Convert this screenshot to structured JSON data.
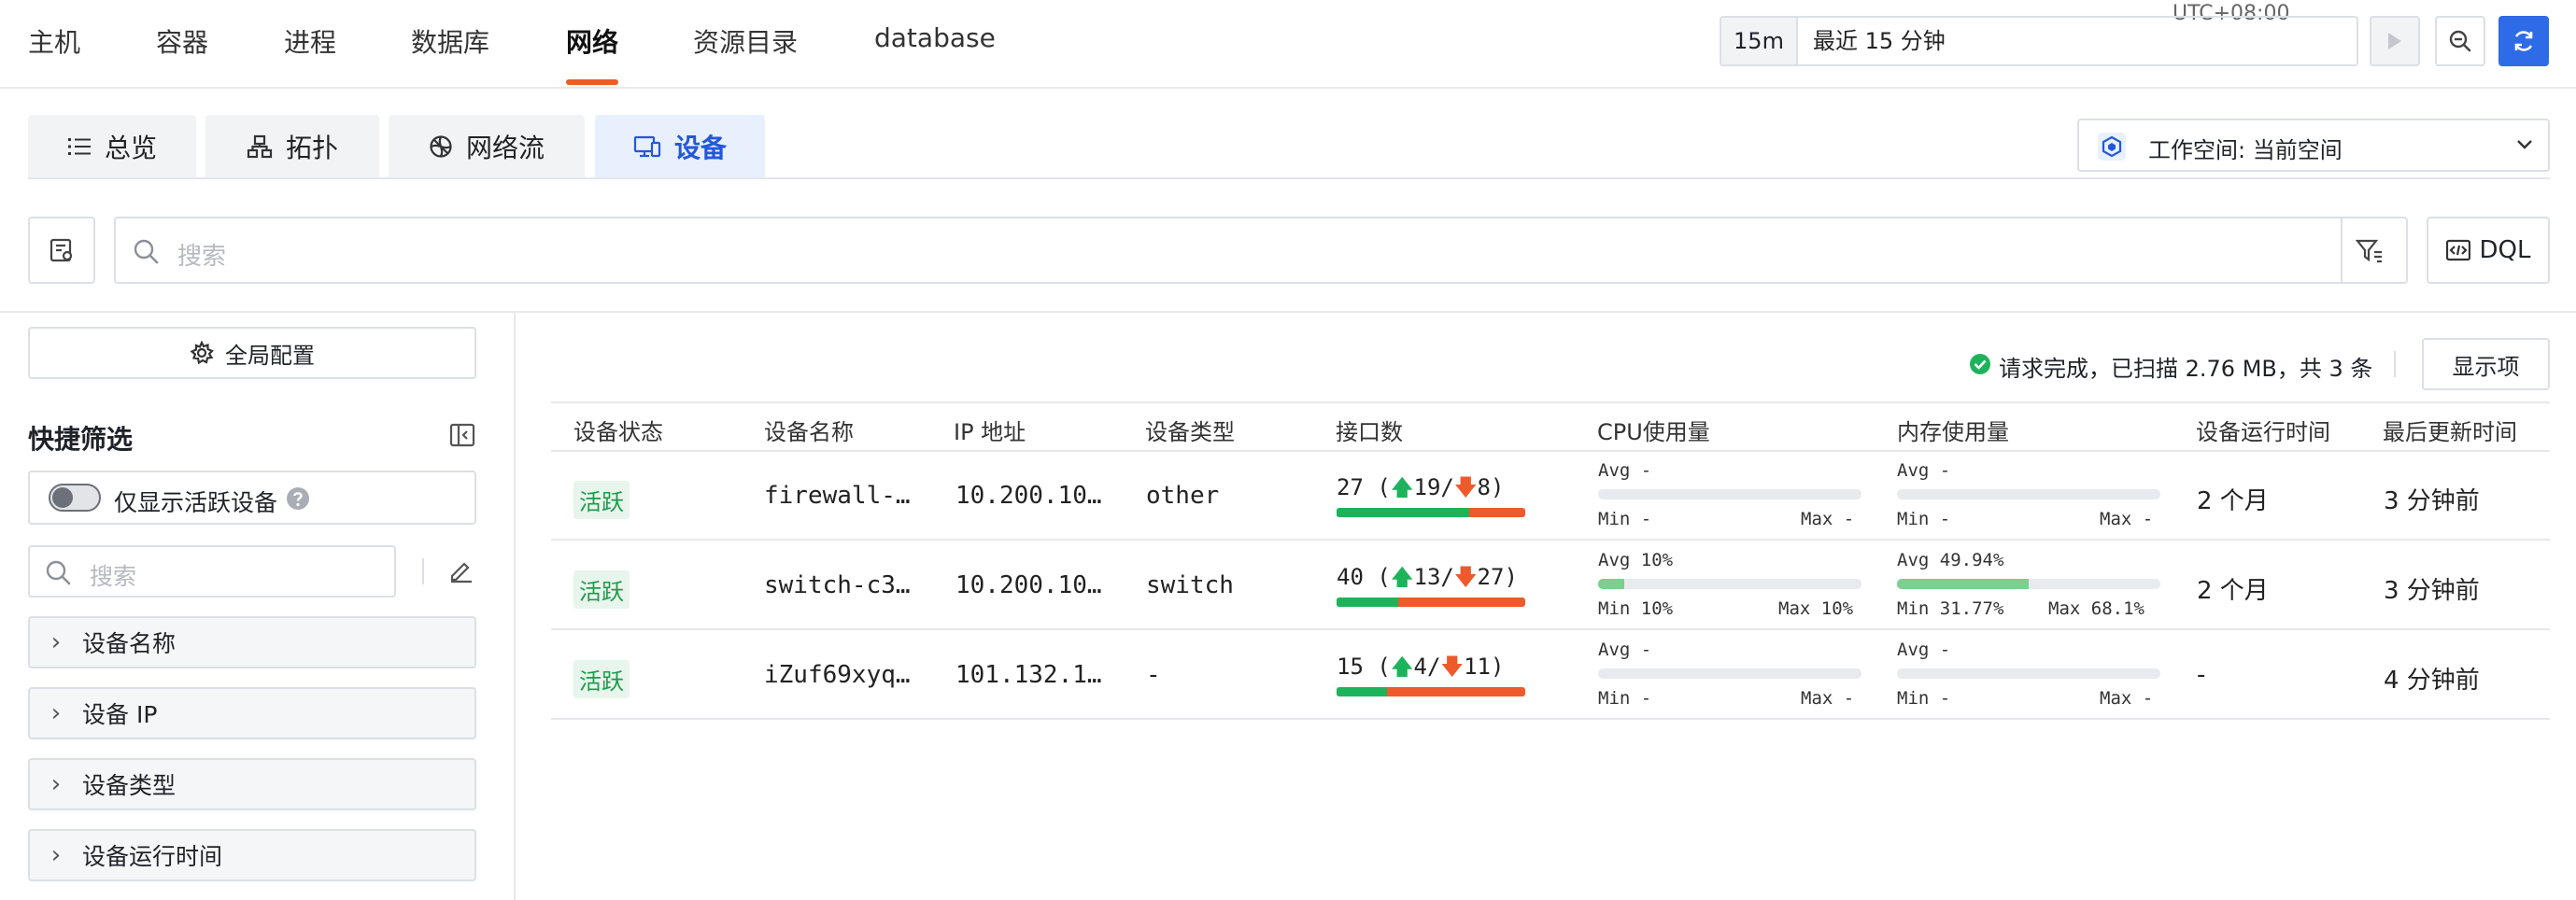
{
  "nav": {
    "items": [
      {
        "label": "主机",
        "active": false
      },
      {
        "label": "容器",
        "active": false
      },
      {
        "label": "进程",
        "active": false
      },
      {
        "label": "数据库",
        "active": false
      },
      {
        "label": "网络",
        "active": true
      },
      {
        "label": "资源目录",
        "active": false
      },
      {
        "label": "database",
        "active": false
      }
    ],
    "timezone": "UTC+08:00",
    "time_short": "15m",
    "time_range": "最近 15 分钟"
  },
  "tabs": [
    {
      "label": "总览",
      "icon": "list-icon",
      "active": false
    },
    {
      "label": "拓扑",
      "icon": "topology-icon",
      "active": false
    },
    {
      "label": "网络流",
      "icon": "network-flow-icon",
      "active": false
    },
    {
      "label": "设备",
      "icon": "device-icon",
      "active": true
    }
  ],
  "workspace": {
    "label": "工作空间: 当前空间"
  },
  "search": {
    "placeholder": "搜索",
    "dql_label": "DQL"
  },
  "sidebar": {
    "global_config": "全局配置",
    "quick_filter_title": "快捷筛选",
    "active_only_label": "仅显示活跃设备",
    "active_only_on": false,
    "search_placeholder": "搜索",
    "facets": [
      "设备名称",
      "设备 IP",
      "设备类型",
      "设备运行时间"
    ]
  },
  "status": {
    "text": "请求完成，已扫描 2.76 MB，共 3 条",
    "display_button": "显示项"
  },
  "table": {
    "headers": [
      "设备状态",
      "设备名称",
      "IP 地址",
      "设备类型",
      "接口数",
      "CPU使用量",
      "内存使用量",
      "设备运行时间",
      "最后更新时间"
    ],
    "rows": [
      {
        "status": "活跃",
        "name": "firewall-…",
        "ip": "10.200.10…",
        "type": "other",
        "if_total": "27",
        "if_up": "19",
        "if_down": "8",
        "if_up_ratio": 0.7037,
        "cpu": {
          "avg": "Avg -",
          "min": "Min -",
          "max": "Max -",
          "fill": 0
        },
        "mem": {
          "avg": "Avg -",
          "min": "Min -",
          "max": "Max -",
          "fill": 0
        },
        "uptime": "2 个月",
        "updated": "3 分钟前"
      },
      {
        "status": "活跃",
        "name": "switch-c3…",
        "ip": "10.200.10…",
        "type": "switch",
        "if_total": "40",
        "if_up": "13",
        "if_down": "27",
        "if_up_ratio": 0.325,
        "cpu": {
          "avg": "Avg 10%",
          "min": "Min 10%",
          "max": "Max 10%",
          "fill": 0.1
        },
        "mem": {
          "avg": "Avg 49.94%",
          "min": "Min 31.77%",
          "max": "Max 68.1%",
          "fill": 0.4994
        },
        "uptime": "2 个月",
        "updated": "3 分钟前"
      },
      {
        "status": "活跃",
        "name": "iZuf69xyq…",
        "ip": "101.132.1…",
        "type": "-",
        "if_total": "15",
        "if_up": "4",
        "if_down": "11",
        "if_up_ratio": 0.2667,
        "cpu": {
          "avg": "Avg -",
          "min": "Min -",
          "max": "Max -",
          "fill": 0
        },
        "mem": {
          "avg": "Avg -",
          "min": "Min -",
          "max": "Max -",
          "fill": 0
        },
        "uptime": "-",
        "updated": "4 分钟前"
      }
    ]
  },
  "colors": {
    "accent": "#2458d9",
    "nav_active": "#ef5b25",
    "active_green": "#1e9a4b",
    "up": "#1db35b",
    "down": "#ee5a2b"
  }
}
